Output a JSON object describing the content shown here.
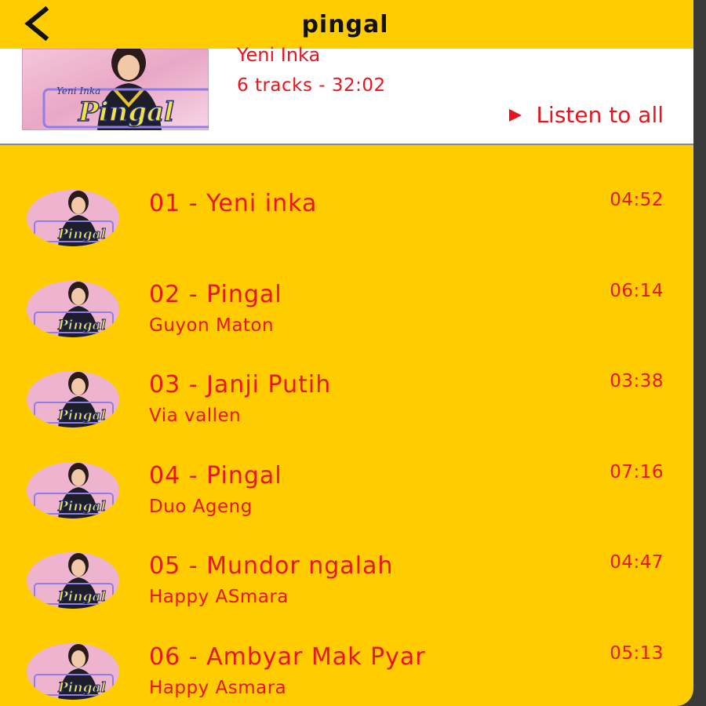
{
  "header": {
    "title": "pingal",
    "back_icon": "chevron-left-icon"
  },
  "album": {
    "artist": "Yeni Inka",
    "meta": "6 tracks - 32:02",
    "listen_all_label": "Listen to all",
    "cover_text": "Pingal",
    "cover_small_text": "Yeni Inka"
  },
  "colors": {
    "background": "#ffcc00",
    "accent": "#e8141e",
    "card": "#ffffff"
  },
  "tracks": [
    {
      "title": "01 - Yeni inka",
      "subtitle": "",
      "duration": "04:52"
    },
    {
      "title": "02 - Pingal",
      "subtitle": "Guyon Maton",
      "duration": "06:14"
    },
    {
      "title": "03 - Janji Putih",
      "subtitle": "Via vallen",
      "duration": "03:38"
    },
    {
      "title": "04 - Pingal",
      "subtitle": "Duo Ageng",
      "duration": "07:16"
    },
    {
      "title": "05 - Mundor ngalah",
      "subtitle": "Happy ASmara",
      "duration": "04:47"
    },
    {
      "title": "06 - Ambyar Mak Pyar",
      "subtitle": "Happy Asmara",
      "duration": "05:13"
    }
  ]
}
